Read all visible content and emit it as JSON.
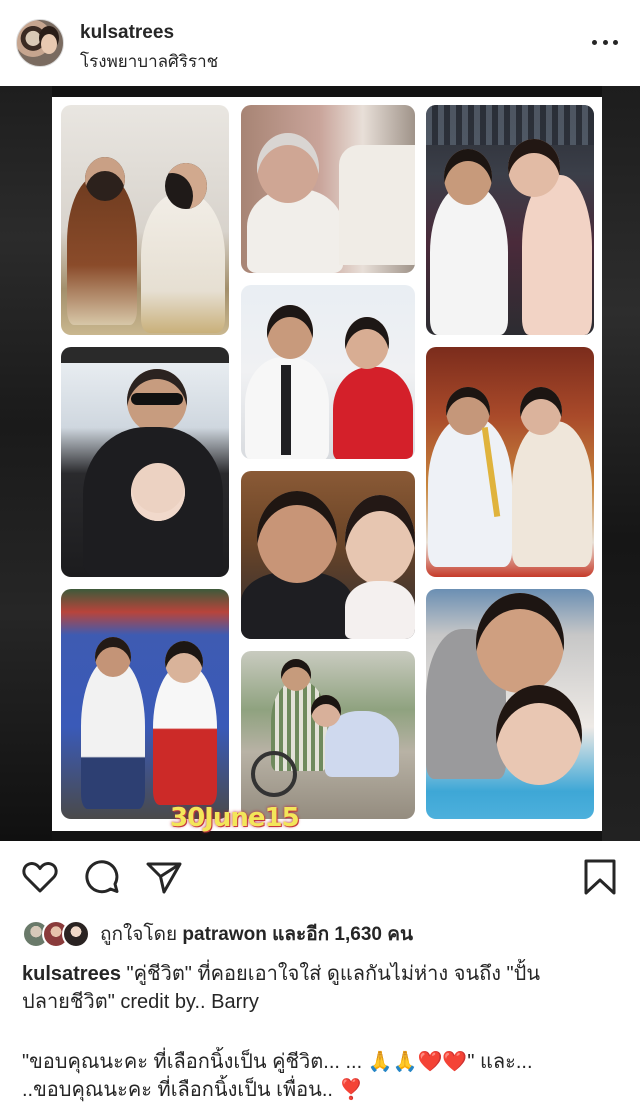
{
  "post": {
    "username": "kulsatrees",
    "location": "โรงพยาบาลศิริราช"
  },
  "photo": {
    "overlay_text": "30June15"
  },
  "likes": {
    "prefix": "ถูกใจโดย",
    "liker": "patrawon",
    "connector": "และอีก",
    "count": "1,630",
    "suffix": "คน"
  },
  "caption": {
    "username": "kulsatrees",
    "line1": "\"คู่ชีวิต\" ที่คอยเอาใจใส่ ดูแลกันไม่ห่าง จนถึง \"ปั้น",
    "line2": "ปลายชีวิต\" credit by.. Barry",
    "line3": "\"ขอบคุณนะคะ ที่เลือกนิ้งเป็น คู่ชีวิต... ... 🙏🙏❤️❤️\" และ...",
    "line4": "..ขอบคุณนะคะ ที่เลือกนิ้งเป็น เพื่อน.. ❣️"
  },
  "colors": {
    "text": "#262626",
    "photo_bg": "#131313",
    "heart": "#e0245e"
  },
  "icons": [
    "more-icon",
    "heart-icon",
    "comment-icon",
    "share-icon",
    "bookmark-icon"
  ]
}
